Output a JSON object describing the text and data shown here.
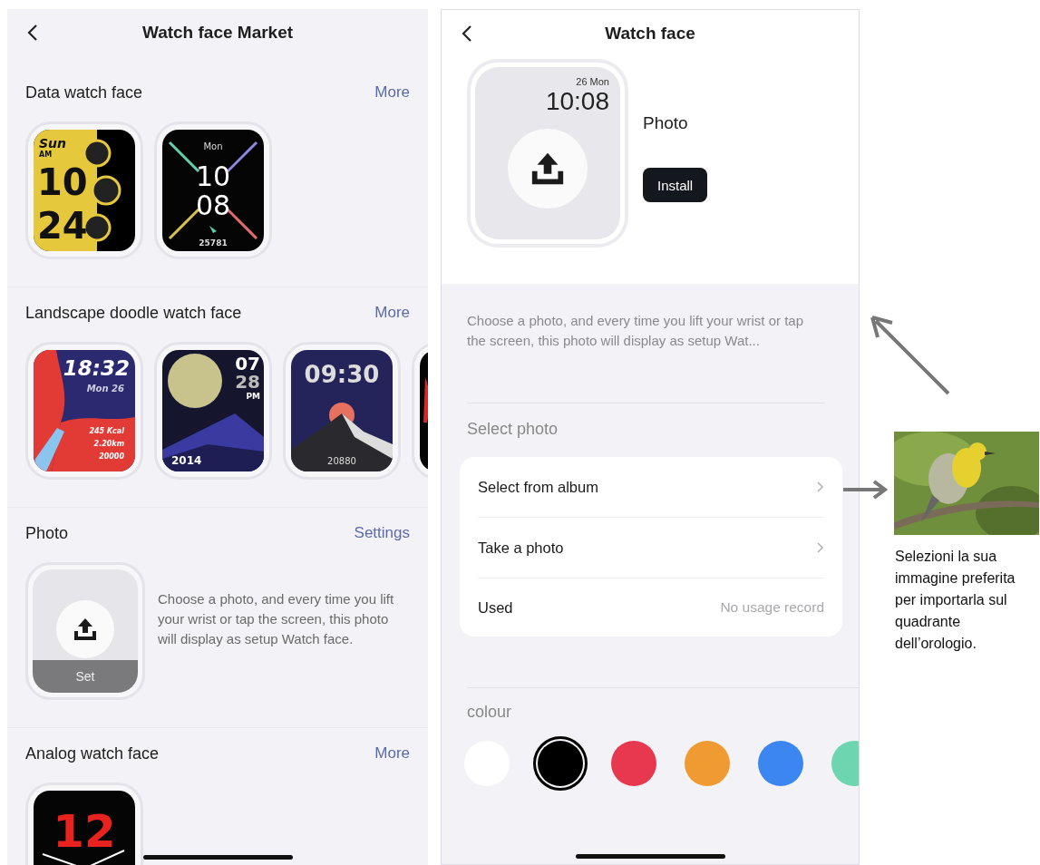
{
  "left": {
    "title": "Watch face Market",
    "sections": [
      {
        "kind": "faces",
        "title": "Data watch face",
        "action": "More",
        "faces": [
          {
            "kind": "yellow",
            "texts": [
              "Sun",
              "AM",
              "10",
              "24"
            ]
          },
          {
            "kind": "cross",
            "texts": [
              "Mon",
              "10",
              "08",
              "25781"
            ]
          }
        ]
      },
      {
        "kind": "faces",
        "title": "Landscape doodle watch face",
        "action": "More",
        "faces": [
          {
            "kind": "beach",
            "texts": [
              "18:32",
              "Mon 26",
              "245 Kcal",
              "2.20km",
              "20000"
            ]
          },
          {
            "kind": "moon",
            "texts": [
              "07",
              "28",
              "PM",
              "2014"
            ]
          },
          {
            "kind": "mountain",
            "texts": [
              "09:30",
              "20880"
            ]
          },
          {
            "kind": "partial"
          }
        ]
      },
      {
        "title": "Photo",
        "action": "Settings",
        "button": "Set",
        "description": "Choose a photo, and every time you lift your wrist or tap the screen, this photo will display as setup Watch face."
      },
      {
        "kind": "faces",
        "title": "Analog watch face",
        "action": "More",
        "faces": [
          {
            "kind": "analog",
            "texts": [
              "12"
            ]
          }
        ]
      }
    ]
  },
  "right": {
    "title": "Watch face",
    "preview": {
      "date": "26 Mon",
      "time": "10:08"
    },
    "name": "Photo",
    "install": "Install",
    "description": "Choose a photo, and every time you lift your wrist or tap the screen, this photo will display as setup Wat...",
    "select_title": "Select photo",
    "options": [
      {
        "kind": "link",
        "label": "Select from album"
      },
      {
        "kind": "link",
        "label": "Take a photo"
      },
      {
        "kind": "value",
        "label": "Used",
        "value": "No usage record"
      }
    ],
    "colour_title": "colour",
    "colours": [
      {
        "color": "#ffffff",
        "selected": false
      },
      {
        "color": "#000000",
        "selected": true
      },
      {
        "color": "#e8384f",
        "selected": false
      },
      {
        "color": "#f09a32",
        "selected": false
      },
      {
        "color": "#3b86f0",
        "selected": false
      },
      {
        "color": "#6dd6b0",
        "selected": false
      }
    ]
  },
  "annotation": {
    "caption": "Selezioni la sua immagine preferita per importarla sul quadrante dell’orologio."
  }
}
